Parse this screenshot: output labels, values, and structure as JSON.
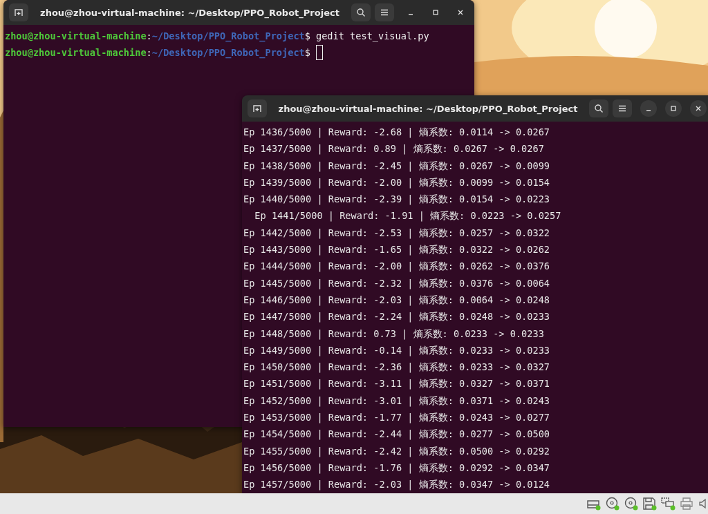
{
  "windows": [
    {
      "title": "zhou@zhou-virtual-machine: ~/Desktop/PPO_Robot_Project",
      "kind": "prompt",
      "lines": [
        {
          "user": "zhou@zhou-virtual-machine",
          "sep": ":",
          "path": "~/Desktop/PPO_Robot_Project",
          "dollar": "$",
          "command": "gedit test_visual.py"
        },
        {
          "user": "zhou@zhou-virtual-machine",
          "sep": ":",
          "path": "~/Desktop/PPO_Robot_Project",
          "dollar": "$",
          "cursor": true
        }
      ]
    },
    {
      "title": "zhou@zhou-virtual-machine: ~/Desktop/PPO_Robot_Project",
      "kind": "log",
      "lines": [
        "Ep 1436/5000 | Reward: -2.68 | 熵系数: 0.0114 -> 0.0267",
        "Ep 1437/5000 | Reward: 0.89 | 熵系数: 0.0267 -> 0.0267",
        "Ep 1438/5000 | Reward: -2.45 | 熵系数: 0.0267 -> 0.0099",
        "Ep 1439/5000 | Reward: -2.00 | 熵系数: 0.0099 -> 0.0154",
        "Ep 1440/5000 | Reward: -2.39 | 熵系数: 0.0154 -> 0.0223",
        "  Ep 1441/5000 | Reward: -1.91 | 熵系数: 0.0223 -> 0.0257",
        "Ep 1442/5000 | Reward: -2.53 | 熵系数: 0.0257 -> 0.0322",
        "Ep 1443/5000 | Reward: -1.65 | 熵系数: 0.0322 -> 0.0262",
        "Ep 1444/5000 | Reward: -2.00 | 熵系数: 0.0262 -> 0.0376",
        "Ep 1445/5000 | Reward: -2.32 | 熵系数: 0.0376 -> 0.0064",
        "Ep 1446/5000 | Reward: -2.03 | 熵系数: 0.0064 -> 0.0248",
        "Ep 1447/5000 | Reward: -2.24 | 熵系数: 0.0248 -> 0.0233",
        "Ep 1448/5000 | Reward: 0.73 | 熵系数: 0.0233 -> 0.0233",
        "Ep 1449/5000 | Reward: -0.14 | 熵系数: 0.0233 -> 0.0233",
        "Ep 1450/5000 | Reward: -2.36 | 熵系数: 0.0233 -> 0.0327",
        "Ep 1451/5000 | Reward: -3.11 | 熵系数: 0.0327 -> 0.0371",
        "Ep 1452/5000 | Reward: -3.01 | 熵系数: 0.0371 -> 0.0243",
        "Ep 1453/5000 | Reward: -1.77 | 熵系数: 0.0243 -> 0.0277",
        "Ep 1454/5000 | Reward: -2.44 | 熵系数: 0.0277 -> 0.0500",
        "Ep 1455/5000 | Reward: -2.42 | 熵系数: 0.0500 -> 0.0292",
        "Ep 1456/5000 | Reward: -1.76 | 熵系数: 0.0292 -> 0.0347",
        "Ep 1457/5000 | Reward: -2.03 | 熵系数: 0.0347 -> 0.0124"
      ]
    }
  ],
  "status_bar": {
    "devices": [
      {
        "kind": "disk"
      },
      {
        "kind": "optical"
      },
      {
        "kind": "optical"
      },
      {
        "kind": "floppy"
      },
      {
        "kind": "network"
      },
      {
        "kind": "printer"
      },
      {
        "kind": "audio"
      }
    ]
  }
}
